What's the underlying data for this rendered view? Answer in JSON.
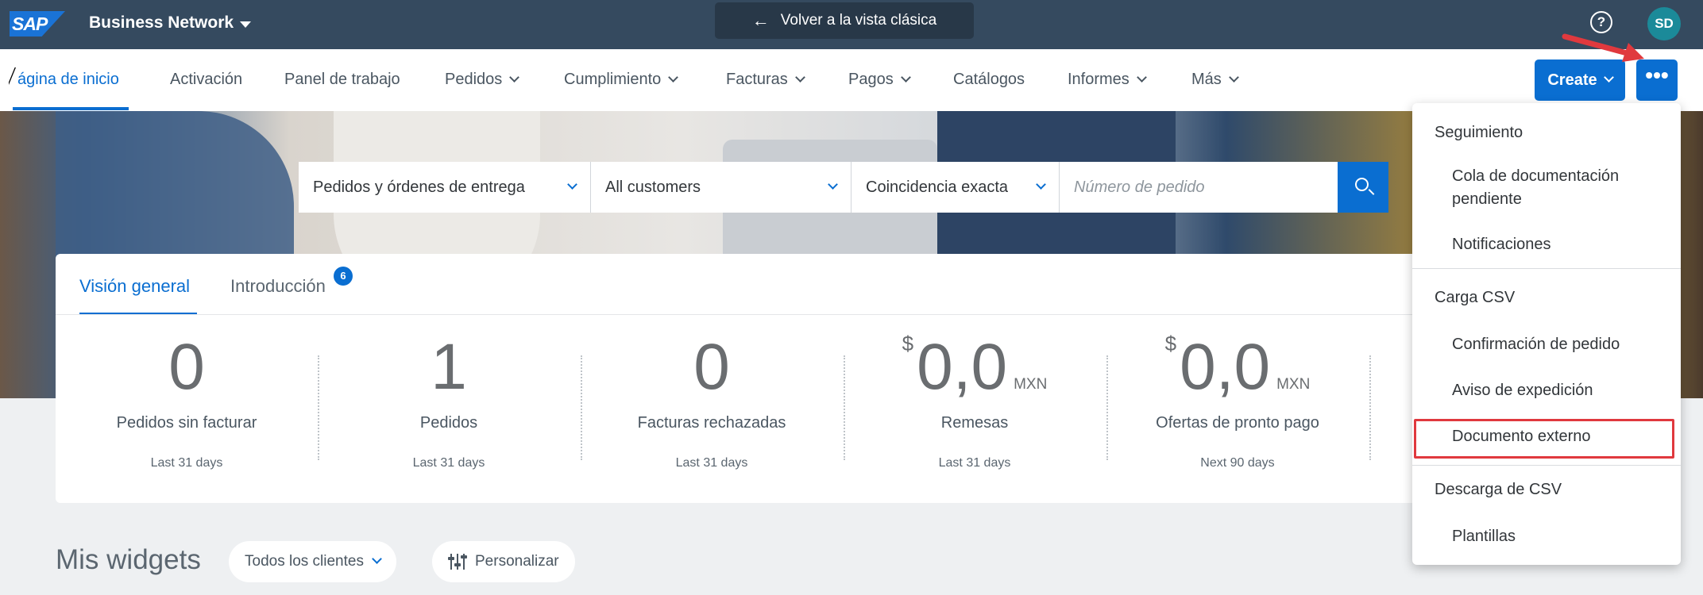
{
  "shell": {
    "logo_text": "SAP",
    "product": "Business Network",
    "classic_link": "Volver a la vista clásica",
    "help_icon": "?",
    "avatar": "SD"
  },
  "nav": {
    "items": [
      {
        "label": "ágina de inicio",
        "active": true
      },
      {
        "label": "Activación"
      },
      {
        "label": "Panel de trabajo"
      },
      {
        "label": "Pedidos",
        "dropdown": true
      },
      {
        "label": "Cumplimiento",
        "dropdown": true
      },
      {
        "label": "Facturas",
        "dropdown": true
      },
      {
        "label": "Pagos",
        "dropdown": true
      },
      {
        "label": "Catálogos"
      },
      {
        "label": "Informes",
        "dropdown": true
      },
      {
        "label": "Más",
        "dropdown": true
      }
    ],
    "create_label": "Create",
    "more_label": "•••"
  },
  "search": {
    "type": "Pedidos y órdenes de entrega",
    "customer": "All customers",
    "match": "Coincidencia exacta",
    "placeholder": "Número de pedido"
  },
  "overview": {
    "tabs": [
      {
        "label": "Visión general",
        "active": true
      },
      {
        "label": "Introducción",
        "badge": "6"
      }
    ],
    "tiles": [
      {
        "value": "0",
        "label": "Pedidos sin facturar",
        "period": "Last 31 days"
      },
      {
        "value": "1",
        "label": "Pedidos",
        "period": "Last 31 days"
      },
      {
        "value": "0",
        "label": "Facturas rechazadas",
        "period": "Last 31 days"
      },
      {
        "currency": "$",
        "value": "0,0",
        "unit": "MXN",
        "label": "Remesas",
        "period": "Last 31 days"
      },
      {
        "currency": "$",
        "value": "0,0",
        "unit": "MXN",
        "label": "Ofertas de pronto pago",
        "period": "Next 90 days"
      }
    ]
  },
  "widgets": {
    "title": "Mis widgets",
    "filter": "Todos los clientes",
    "customize": "Personalizar"
  },
  "menu": {
    "sections": [
      {
        "header": "Seguimiento",
        "items": [
          "Cola de documentación pendiente",
          "Notificaciones"
        ]
      },
      {
        "header": "Carga CSV",
        "items": [
          "Confirmación de pedido",
          "Aviso de expedición",
          "Documento externo"
        ]
      },
      {
        "header": "Descarga de CSV",
        "items": [
          "Plantillas"
        ]
      }
    ],
    "highlighted_item": "Documento externo"
  },
  "colors": {
    "shell": "#354a5f",
    "accent": "#0a6ed1",
    "highlight": "#e0393e"
  }
}
